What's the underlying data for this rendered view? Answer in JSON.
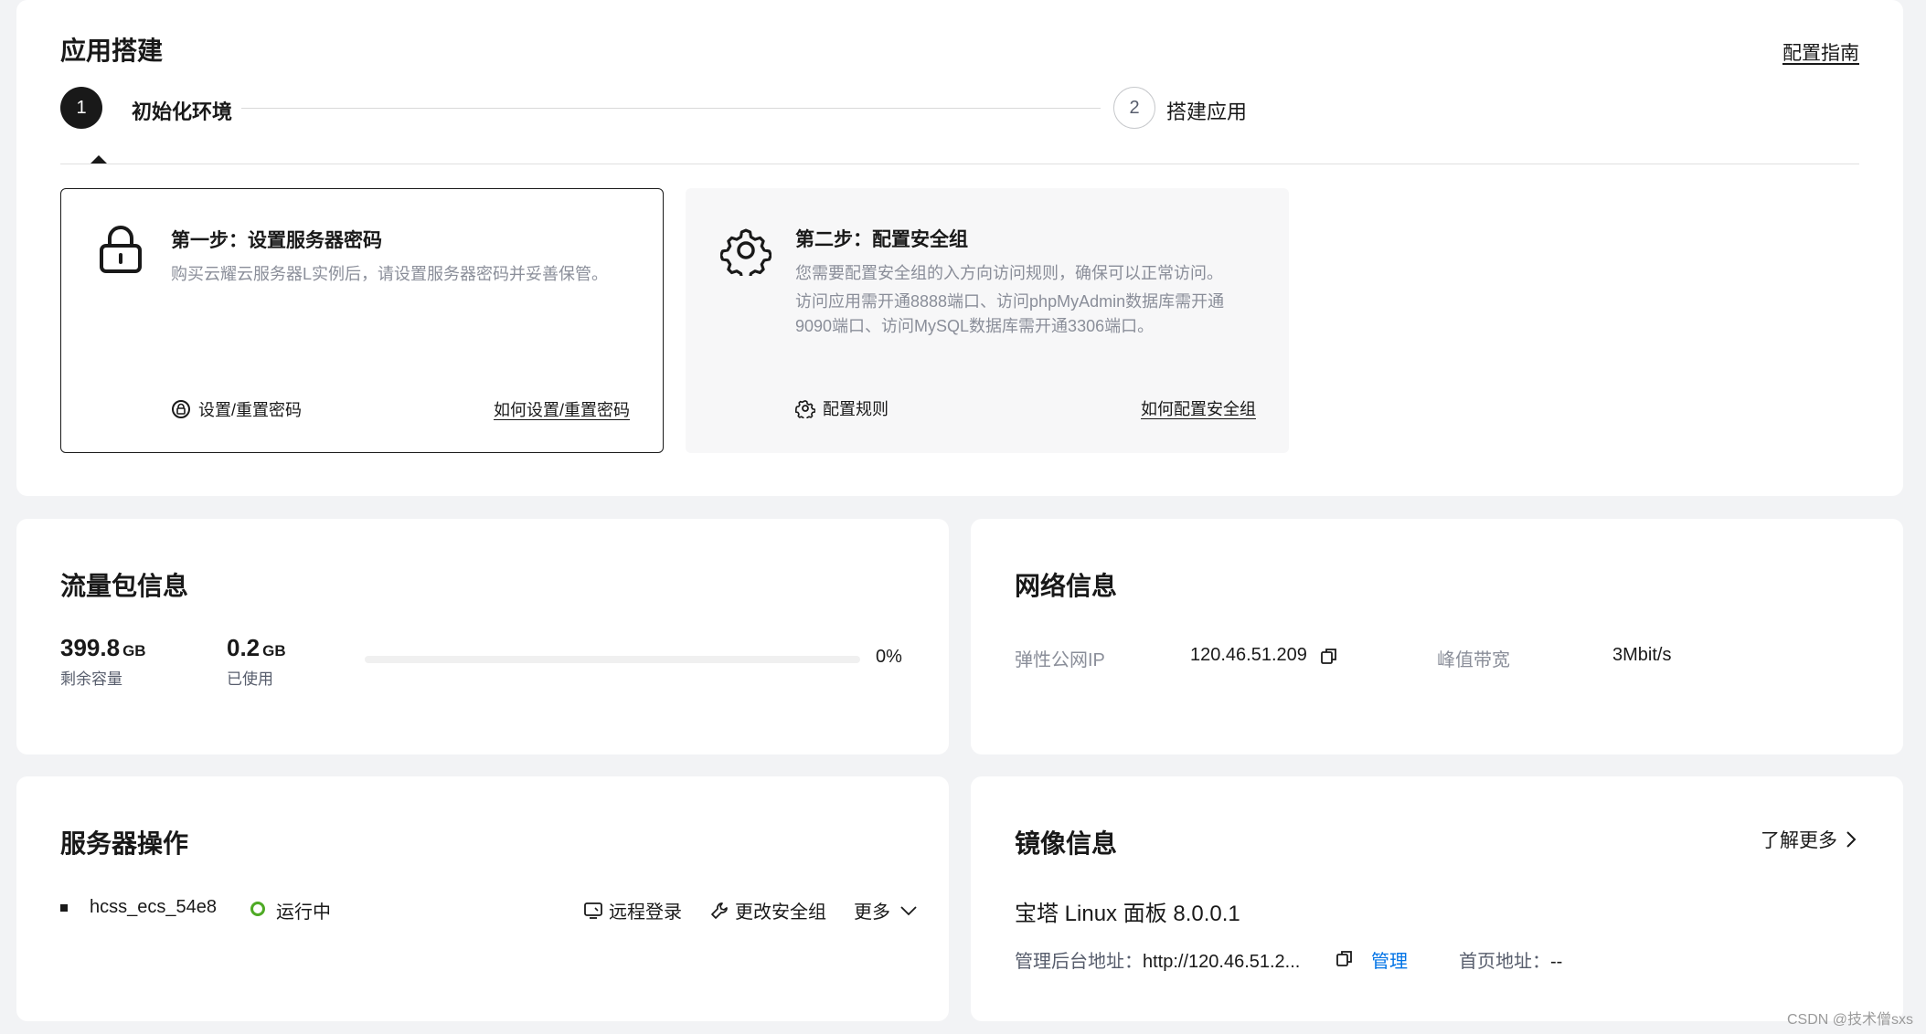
{
  "build": {
    "title": "应用搭建",
    "guide_link": "配置指南",
    "steps": [
      {
        "number": "1",
        "label": "初始化环境"
      },
      {
        "number": "2",
        "label": "搭建应用"
      }
    ],
    "cards": [
      {
        "icon": "lock-icon",
        "title": "第一步：设置服务器密码",
        "desc": [
          "购买云耀云服务器L实例后，请设置服务器密码并妥善保管。"
        ],
        "action": "设置/重置密码",
        "howto": "如何设置/重置密码"
      },
      {
        "icon": "gear-icon",
        "title": "第二步：配置安全组",
        "desc": [
          "您需要配置安全组的入方向访问规则，确保可以正常访问。",
          "访问应用需开通8888端口、访问phpMyAdmin数据库需开通9090端口、访问MySQL数据库需开通3306端口。"
        ],
        "action": "配置规则",
        "howto": "如何配置安全组"
      }
    ]
  },
  "traffic": {
    "title": "流量包信息",
    "remaining": {
      "value": "399.8",
      "unit": "GB",
      "caption": "剩余容量"
    },
    "used": {
      "value": "0.2",
      "unit": "GB",
      "caption": "已使用"
    },
    "progress_percent": 0,
    "progress_label": "0%"
  },
  "network": {
    "title": "网络信息",
    "ip_label": "弹性公网IP",
    "ip_value": "120.46.51.209",
    "bandwidth_label": "峰值带宽",
    "bandwidth_value": "3Mbit/s"
  },
  "ops": {
    "title": "服务器操作",
    "server_name": "hcss_ecs_54e8",
    "status": "运行中",
    "status_color": "#4eaa25",
    "remote_login": "远程登录",
    "change_sg": "更改安全组",
    "more": "更多"
  },
  "image": {
    "title": "镜像信息",
    "learn_more": "了解更多",
    "name": "宝塔 Linux 面板 8.0.0.1",
    "admin_label": "管理后台地址：",
    "admin_value": "http://120.46.51.2...",
    "manage": "管理",
    "home_label": "首页地址：",
    "home_value": "--"
  },
  "watermark": "CSDN @技术僧sxs"
}
